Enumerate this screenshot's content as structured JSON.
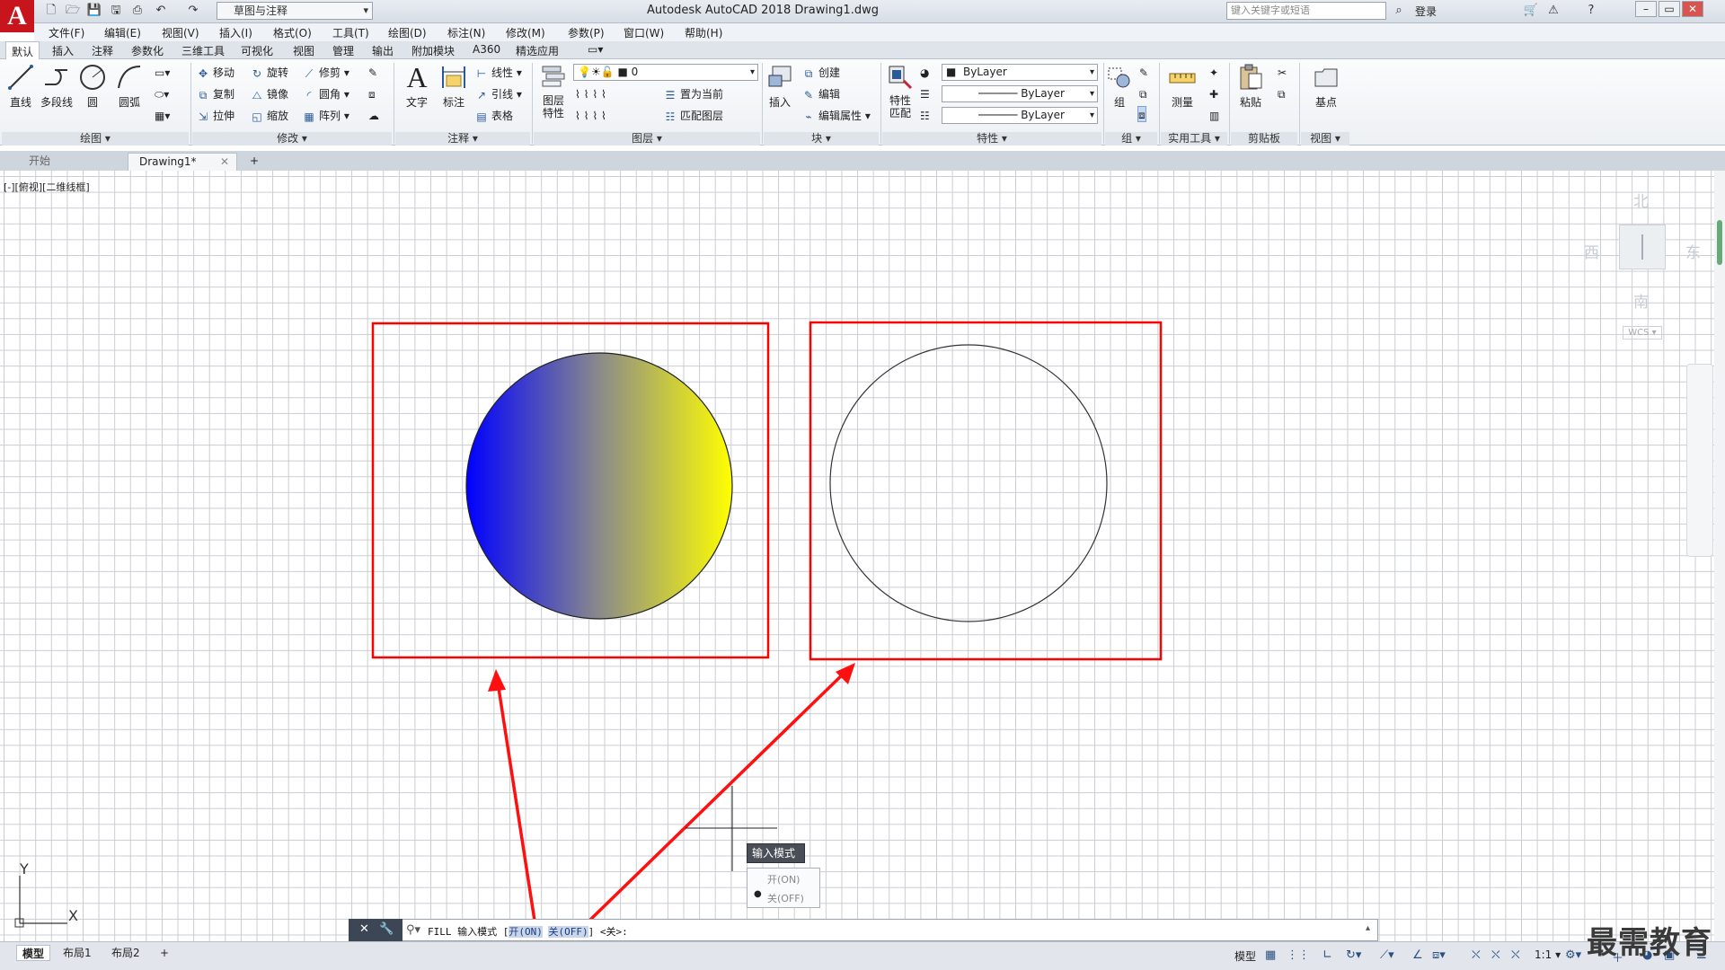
{
  "app": {
    "title": "Autodesk AutoCAD 2018    Drawing1.dwg",
    "workspace": "草图与注释",
    "search_placeholder": "键入关键字或短语",
    "login": "登录"
  },
  "menu": [
    "文件(F)",
    "编辑(E)",
    "视图(V)",
    "插入(I)",
    "格式(O)",
    "工具(T)",
    "绘图(D)",
    "标注(N)",
    "修改(M)",
    "参数(P)",
    "窗口(W)",
    "帮助(H)"
  ],
  "ribbon_tabs": [
    "默认",
    "插入",
    "注释",
    "参数化",
    "三维工具",
    "可视化",
    "视图",
    "管理",
    "输出",
    "附加模块",
    "A360",
    "精选应用"
  ],
  "ribbon": {
    "draw": {
      "title": "绘图",
      "line": "直线",
      "polyline": "多段线",
      "circle": "圆",
      "arc": "圆弧"
    },
    "modify": {
      "title": "修改",
      "move": "移动",
      "rotate": "旋转",
      "trim": "修剪",
      "copy": "复制",
      "mirror": "镜像",
      "fillet": "圆角",
      "stretch": "拉伸",
      "scale": "缩放",
      "array": "阵列"
    },
    "annotation": {
      "title": "注释",
      "text": "文字",
      "dimension": "标注",
      "linear": "线性",
      "leader": "引线",
      "table": "表格"
    },
    "layers": {
      "title": "图层",
      "props": "图层特性",
      "current_layer": "0",
      "make_current": "置为当前",
      "match_layer": "匹配图层"
    },
    "block": {
      "title": "块",
      "insert": "插入",
      "create": "创建",
      "edit": "编辑",
      "edit_attr": "编辑属性"
    },
    "properties": {
      "title": "特性",
      "match": "特性匹配",
      "color": "ByLayer",
      "linetype": "ByLayer",
      "lineweight": "ByLayer"
    },
    "groups": {
      "title": "组",
      "group": "组"
    },
    "utilities": {
      "title": "实用工具",
      "measure": "测量"
    },
    "clipboard": {
      "title": "剪贴板",
      "paste": "粘贴"
    },
    "view": {
      "title": "视图",
      "base": "基点"
    }
  },
  "file_tabs": [
    "开始",
    "Drawing1*"
  ],
  "viewport_label": "[-][俯视][二维线框]",
  "viewcube": {
    "north": "北",
    "south": "南",
    "east": "东",
    "west": "西",
    "wcs": "WCS"
  },
  "ucs": {
    "x": "X",
    "y": "Y"
  },
  "input_mode": {
    "title": "输入模式",
    "on": "开(ON)",
    "off": "关(OFF)",
    "selected": "off"
  },
  "command": {
    "prefix": "FILL 输入模式 [",
    "on": "开(ON)",
    "off": "关(OFF)",
    "suffix": "] <关>:"
  },
  "layout_tabs": [
    "模型",
    "布局1",
    "布局2"
  ],
  "status": {
    "model": "模型",
    "scale": "1:1"
  },
  "watermark": "最需教育",
  "colors": {
    "gradient_left": "#0000ff",
    "gradient_mid": "#8a8a8a",
    "gradient_right": "#ffff00",
    "highlight_box": "#ff0000",
    "autocad_red": "#c8141d"
  }
}
